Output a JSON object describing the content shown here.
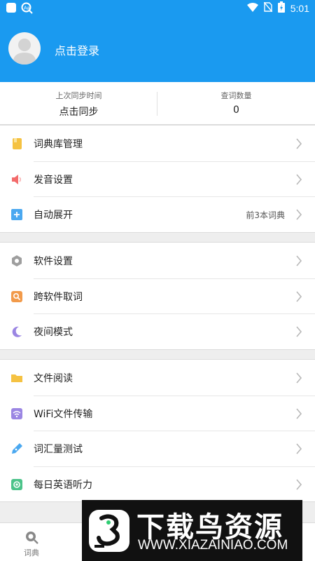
{
  "status_bar": {
    "time": "5:01"
  },
  "header": {
    "login_text": "点击登录"
  },
  "sync": {
    "last_sync_label": "上次同步时间",
    "last_sync_value": "点击同步",
    "word_count_label": "查词数量",
    "word_count_value": "0"
  },
  "menu_groups": [
    [
      {
        "label": "词典库管理",
        "icon": "dictionary-book-icon",
        "color": "#f5c242"
      },
      {
        "label": "发音设置",
        "icon": "speaker-icon",
        "color": "#f36b6b"
      },
      {
        "label": "自动展开",
        "icon": "plus-square-icon",
        "color": "#4aa8f0",
        "extra": "前3本词典"
      }
    ],
    [
      {
        "label": "软件设置",
        "icon": "gear-hexagon-icon",
        "color": "#9e9e9e"
      },
      {
        "label": "跨软件取词",
        "icon": "search-square-icon",
        "color": "#f29a4a"
      },
      {
        "label": "夜间模式",
        "icon": "moon-icon",
        "color": "#9b86e3"
      }
    ],
    [
      {
        "label": "文件阅读",
        "icon": "folder-icon",
        "color": "#f5c242"
      },
      {
        "label": "WiFi文件传输",
        "icon": "wifi-icon",
        "color": "#9b86e3"
      },
      {
        "label": "词汇量测试",
        "icon": "pen-icon",
        "color": "#4aa8f0"
      },
      {
        "label": "每日英语听力",
        "icon": "record-icon",
        "color": "#4cc38a"
      }
    ]
  ],
  "tabbar": {
    "tabs": [
      {
        "label": "词典"
      },
      {
        "label": ""
      },
      {
        "label": ""
      },
      {
        "label": ""
      },
      {
        "label": ""
      }
    ]
  },
  "watermark": {
    "title": "下载鸟资源",
    "url": "WWW.XIAZAINIAO.COM"
  },
  "colors": {
    "primary": "#1a9af0",
    "background": "#eeeeee"
  }
}
